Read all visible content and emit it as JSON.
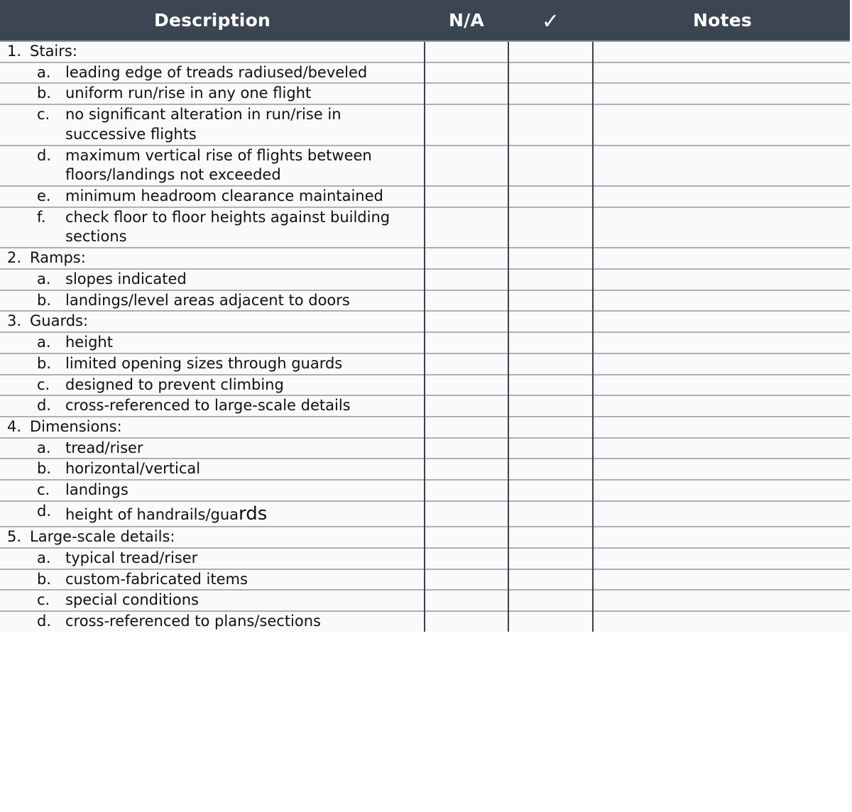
{
  "table": {
    "columns": [
      {
        "key": "description",
        "label": "Description",
        "align": "center"
      },
      {
        "key": "na",
        "label": "N/A",
        "align": "center"
      },
      {
        "key": "check",
        "label": "✓",
        "icon": "checkmark-icon",
        "align": "center"
      },
      {
        "key": "notes",
        "label": "Notes",
        "align": "center"
      }
    ],
    "header_background": "#3c4552",
    "header_text_color": "#ffffff",
    "row_background": "#fafafa",
    "input_cell_background": "#000000",
    "divider_color": "#a9b1bc",
    "rows": [
      {
        "level": "num",
        "marker": "1.",
        "label": "Stairs:"
      },
      {
        "level": "alpha",
        "marker": "a.",
        "label": "leading edge of treads radiused/beveled"
      },
      {
        "level": "alpha",
        "marker": "b.",
        "label": "uniform run/rise in any one flight"
      },
      {
        "level": "alpha",
        "marker": "c.",
        "label": "no significant alteration in run/rise in successive flights"
      },
      {
        "level": "alpha",
        "marker": "d.",
        "label": "maximum vertical rise of flights between floors/landings not exceeded"
      },
      {
        "level": "alpha",
        "marker": "e.",
        "label": "minimum headroom clearance maintained"
      },
      {
        "level": "alpha",
        "marker": "f.",
        "label": "check floor to floor heights against building sections"
      },
      {
        "level": "num",
        "marker": "2.",
        "label": "Ramps:"
      },
      {
        "level": "alpha",
        "marker": "a.",
        "label": "slopes indicated"
      },
      {
        "level": "alpha",
        "marker": "b.",
        "label": "landings/level areas adjacent to doors"
      },
      {
        "level": "num",
        "marker": "3.",
        "label": "Guards:"
      },
      {
        "level": "alpha",
        "marker": "a.",
        "label": "height"
      },
      {
        "level": "alpha",
        "marker": "b.",
        "label": "limited opening sizes through guards"
      },
      {
        "level": "alpha",
        "marker": "c.",
        "label": "designed to prevent climbing"
      },
      {
        "level": "alpha",
        "marker": "d.",
        "label": "cross-referenced to large-scale details"
      },
      {
        "level": "num",
        "marker": "4.",
        "label": "Dimensions:"
      },
      {
        "level": "alpha",
        "marker": "a.",
        "label": "tread/riser"
      },
      {
        "level": "alpha",
        "marker": "b.",
        "label": "horizontal/vertical"
      },
      {
        "level": "alpha",
        "marker": "c.",
        "label": "landings"
      },
      {
        "level": "alpha",
        "marker": "d.",
        "label": "height of handrails/gua",
        "label_tail": "rds"
      },
      {
        "level": "num",
        "marker": "5.",
        "label": "Large-scale details:"
      },
      {
        "level": "alpha",
        "marker": "a.",
        "label": "typical tread/riser"
      },
      {
        "level": "alpha",
        "marker": "b.",
        "label": "custom-fabricated items"
      },
      {
        "level": "alpha",
        "marker": "c.",
        "label": "special conditions"
      },
      {
        "level": "alpha",
        "marker": "d.",
        "label": "cross-referenced to plans/sections"
      }
    ]
  }
}
